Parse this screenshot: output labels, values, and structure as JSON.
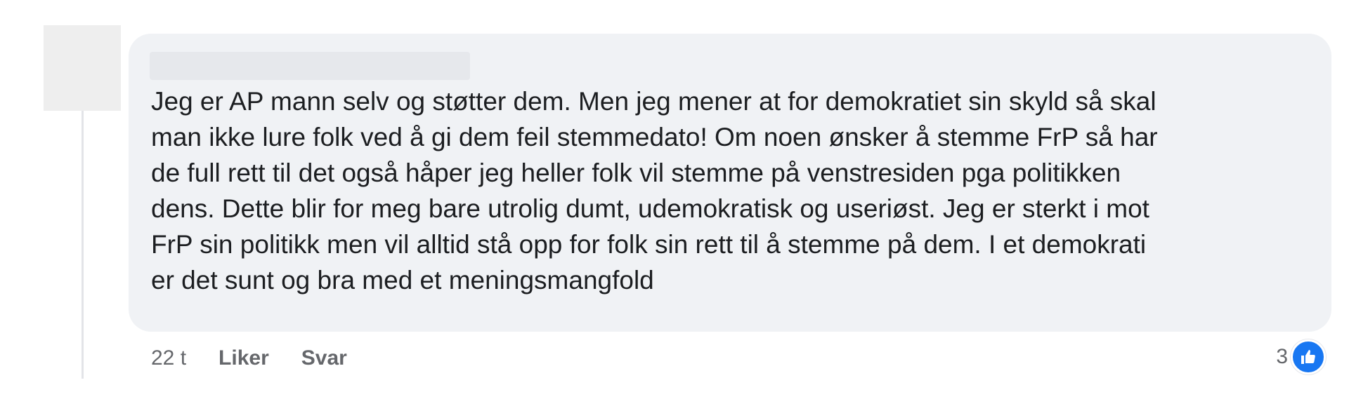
{
  "comment": {
    "text": "Jeg er AP mann selv og støtter dem. Men jeg mener at for demokratiet sin skyld så skal\nman ikke lure folk ved å gi dem feil stemmedato! Om noen ønsker å stemme FrP så har\nde full rett til det også håper jeg heller folk vil stemme på venstresiden pga politikken\ndens. Dette blir for meg bare utrolig dumt, udemokratisk og useriøst. Jeg er sterkt i mot\nFrP sin politikk men vil alltid stå opp for folk sin rett til å stemme på dem. I et demokrati\ner det sunt og bra med et meningsmangfold",
    "timestamp": "22 t",
    "like_label": "Liker",
    "reply_label": "Svar",
    "reaction_count": "3",
    "reaction_icon": "like-thumbs-up-icon"
  },
  "colors": {
    "bubble_bg": "#f0f2f5",
    "text": "#1c1e21",
    "meta_text": "#65676b",
    "like_blue": "#1877f2"
  }
}
